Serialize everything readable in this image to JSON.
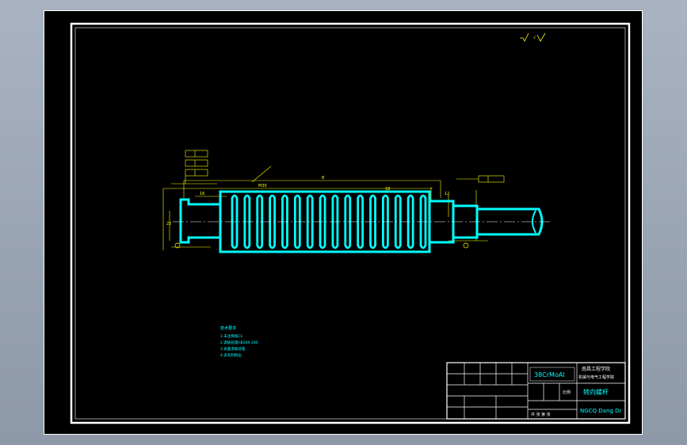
{
  "title_block": {
    "material": "38CrMoAl",
    "institution_line1": "南昌工程学院",
    "institution_line2": "机械与电气工程学院",
    "part_name": "转向螺杆",
    "drawing_code": "NGCQ Dang Dr",
    "scale_label": "比例",
    "sheet_label": "共 张 第 张"
  },
  "tech_notes": {
    "heading": "技术要求",
    "items": [
      "1.未注倒角C1",
      "2.调质处理HB240-280",
      "3.表面渗氮处理",
      "4.去毛刺锐边"
    ]
  },
  "dimension_labels": {
    "overall_length": "8",
    "left_dim": "16",
    "diameter": "22",
    "thread_pitch": "M30",
    "right_dim": "18",
    "right_dim2": "12"
  },
  "colors": {
    "background": "#000000",
    "part_outline": "#00ffff",
    "dimensions": "#ffff00",
    "border": "#ffffff"
  }
}
